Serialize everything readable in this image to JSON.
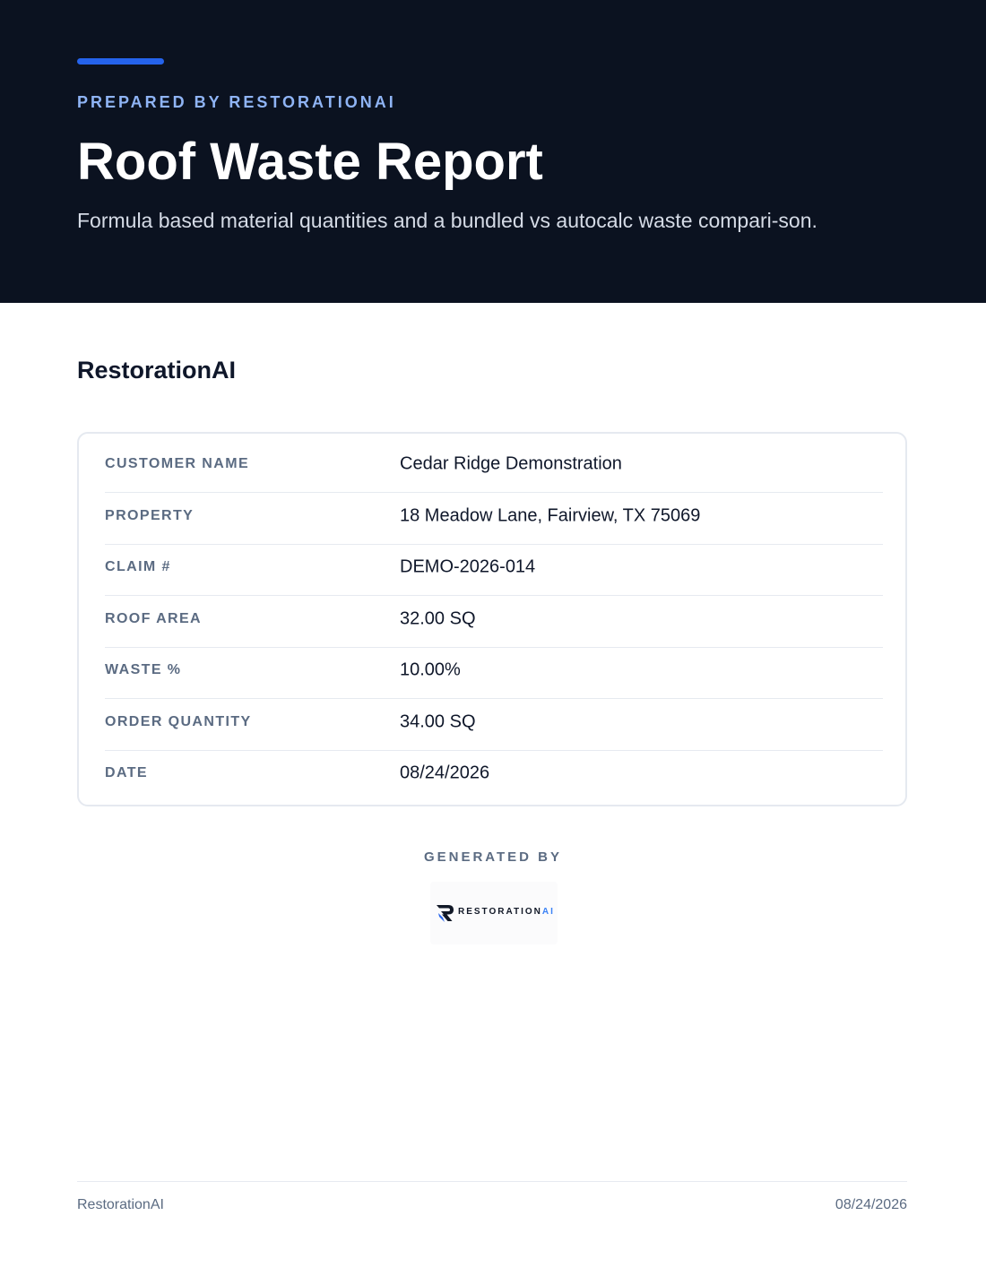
{
  "header": {
    "eyebrow": "PREPARED BY RESTORATIONAI",
    "title": "Roof Waste Report",
    "subtitle": "Formula based material quantities and a bundled vs autocalc waste compari-son."
  },
  "brand_heading": "RestorationAI",
  "info": [
    {
      "label": "CUSTOMER NAME",
      "value": "Cedar Ridge Demonstration"
    },
    {
      "label": "PROPERTY",
      "value": "18 Meadow Lane, Fairview, TX 75069"
    },
    {
      "label": "CLAIM #",
      "value": "DEMO-2026-014"
    },
    {
      "label": "ROOF AREA",
      "value": "32.00 SQ"
    },
    {
      "label": "WASTE %",
      "value": "10.00%"
    },
    {
      "label": "ORDER QUANTITY",
      "value": "34.00 SQ"
    },
    {
      "label": "DATE",
      "value": "08/24/2026"
    }
  ],
  "generated": {
    "label": "GENERATED BY",
    "logo_text_main": "RESTORATION",
    "logo_text_accent": "AI",
    "logo_icon": "restorationai-r-logo-icon"
  },
  "footer": {
    "left": "RestorationAI",
    "right": "08/24/2026"
  },
  "colors": {
    "header_bg": "#0b1220",
    "accent": "#2563eb",
    "eyebrow": "#8fb4f5",
    "label": "#5b6b82"
  }
}
